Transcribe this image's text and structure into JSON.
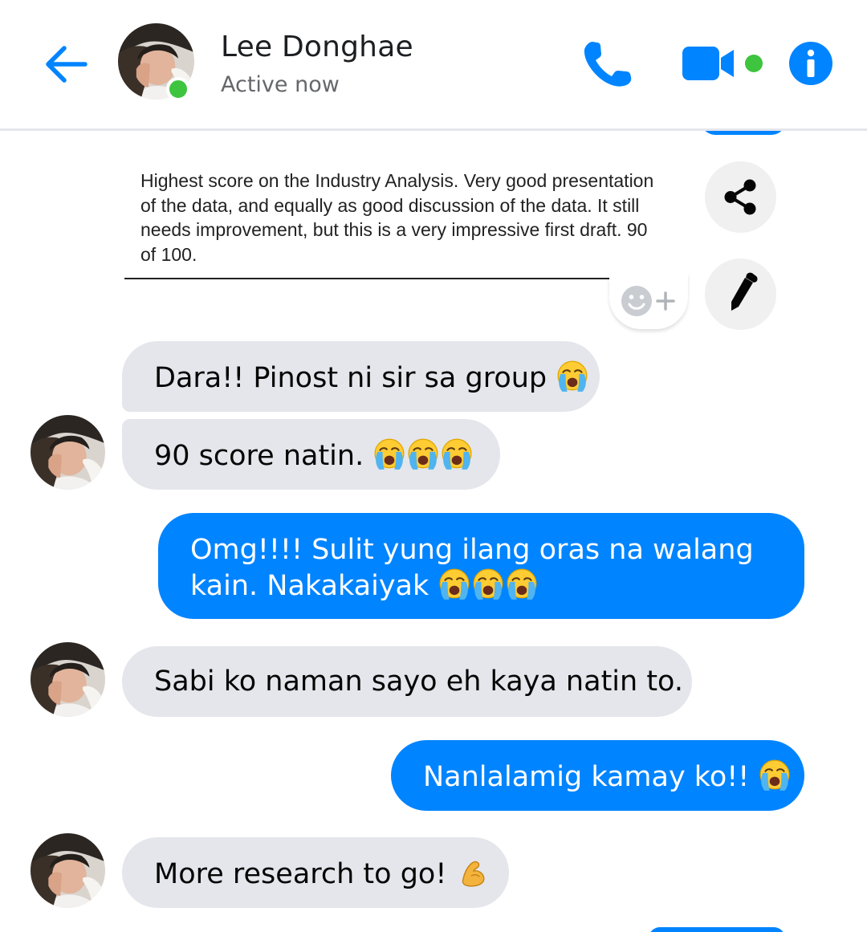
{
  "header": {
    "contact_name": "Lee Donghae",
    "status": "Active now",
    "accent_color": "#0084ff",
    "online_color": "#3ec43e",
    "icons": [
      "back-arrow-icon",
      "phone-icon",
      "video-camera-icon",
      "info-icon"
    ]
  },
  "shared_post": {
    "text": "Highest score on the Industry Analysis. Very good presentation of the data, and equally as good discussion of the data. It still needs improvement, but this is a very impressive first draft. 90 of 100.",
    "actions": [
      "share-icon",
      "edit-pencil-icon",
      "add-reaction-icon"
    ]
  },
  "messages": [
    {
      "sender": "contact",
      "text": "Dara!! Pinost ni sir sa group",
      "emoji_count": 1,
      "emoji": "loudly-crying-face"
    },
    {
      "sender": "contact",
      "text": "90 score natin.",
      "emoji_count": 3,
      "emoji": "loudly-crying-face"
    },
    {
      "sender": "me",
      "line1": "Omg!!!! Sulit yung ilang oras na walang",
      "line2": "kain. Nakakaiyak",
      "emoji_count": 3,
      "emoji": "loudly-crying-face"
    },
    {
      "sender": "contact",
      "text": "Sabi ko naman sayo eh kaya natin to.",
      "emoji_count": 0
    },
    {
      "sender": "me",
      "text": "Nanlalamig kamay ko!!",
      "emoji_count": 1,
      "emoji": "loudly-crying-face"
    },
    {
      "sender": "contact",
      "text": "More research to go!",
      "emoji_count": 1,
      "emoji": "flexed-biceps"
    }
  ],
  "colors": {
    "incoming_bubble": "#e4e6eb",
    "outgoing_bubble": "#0084ff"
  }
}
